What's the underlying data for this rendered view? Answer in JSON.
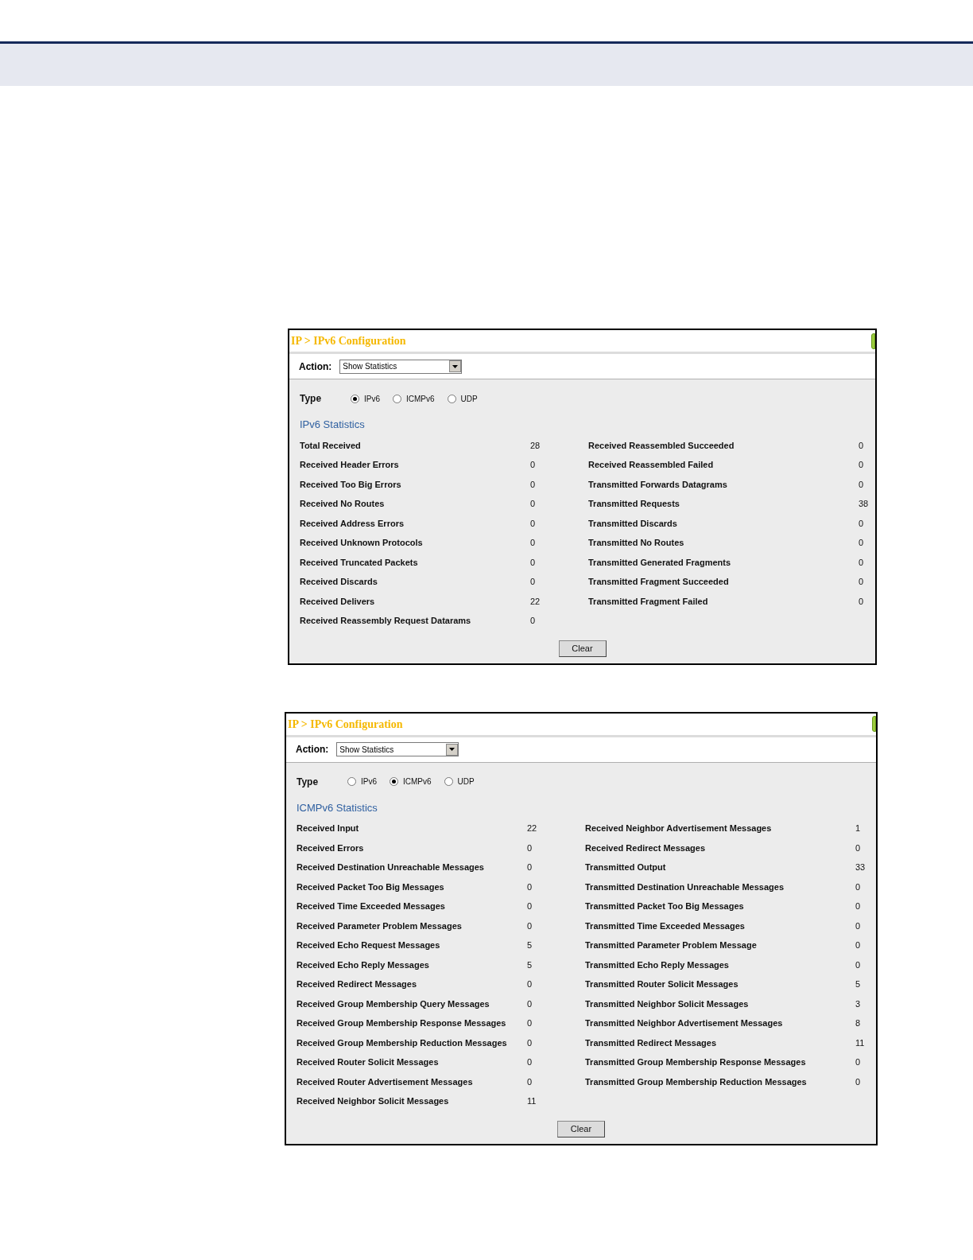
{
  "panels": [
    {
      "title": "IP > IPv6 Configuration",
      "action_label": "Action:",
      "action_value": "Show Statistics",
      "type_label": "Type",
      "types": [
        {
          "label": "IPv6",
          "selected": true
        },
        {
          "label": "ICMPv6",
          "selected": false
        },
        {
          "label": "UDP",
          "selected": false
        }
      ],
      "section_title": "IPv6 Statistics",
      "left": [
        {
          "label": "Total Received",
          "value": "28"
        },
        {
          "label": "Received Header Errors",
          "value": "0"
        },
        {
          "label": "Received Too Big Errors",
          "value": "0"
        },
        {
          "label": "Received No Routes",
          "value": "0"
        },
        {
          "label": "Received Address Errors",
          "value": "0"
        },
        {
          "label": "Received Unknown Protocols",
          "value": "0"
        },
        {
          "label": "Received Truncated Packets",
          "value": "0"
        },
        {
          "label": "Received Discards",
          "value": "0"
        },
        {
          "label": "Received Delivers",
          "value": "22"
        },
        {
          "label": "Received Reassembly Request Datarams",
          "value": "0"
        }
      ],
      "right": [
        {
          "label": "Received Reassembled Succeeded",
          "value": "0"
        },
        {
          "label": "Received Reassembled Failed",
          "value": "0"
        },
        {
          "label": "Transmitted Forwards Datagrams",
          "value": "0"
        },
        {
          "label": "Transmitted Requests",
          "value": "38"
        },
        {
          "label": "Transmitted Discards",
          "value": "0"
        },
        {
          "label": "Transmitted No Routes",
          "value": "0"
        },
        {
          "label": "Transmitted Generated Fragments",
          "value": "0"
        },
        {
          "label": "Transmitted Fragment Succeeded",
          "value": "0"
        },
        {
          "label": "Transmitted Fragment Failed",
          "value": "0"
        }
      ],
      "button": "Clear"
    },
    {
      "title": "IP > IPv6 Configuration",
      "action_label": "Action:",
      "action_value": "Show Statistics",
      "type_label": "Type",
      "types": [
        {
          "label": "IPv6",
          "selected": false
        },
        {
          "label": "ICMPv6",
          "selected": true
        },
        {
          "label": "UDP",
          "selected": false
        }
      ],
      "section_title": "ICMPv6 Statistics",
      "left": [
        {
          "label": "Received Input",
          "value": "22"
        },
        {
          "label": "Received Errors",
          "value": "0"
        },
        {
          "label": "Received Destination Unreachable Messages",
          "value": "0"
        },
        {
          "label": "Received Packet Too Big Messages",
          "value": "0"
        },
        {
          "label": "Received Time Exceeded Messages",
          "value": "0"
        },
        {
          "label": "Received Parameter Problem Messages",
          "value": "0"
        },
        {
          "label": "Received Echo Request Messages",
          "value": "5"
        },
        {
          "label": "Received Echo Reply Messages",
          "value": "5"
        },
        {
          "label": "Received Redirect Messages",
          "value": "0"
        },
        {
          "label": "Received Group Membership Query Messages",
          "value": "0"
        },
        {
          "label": "Received Group Membership Response Messages",
          "value": "0"
        },
        {
          "label": "Received Group Membership Reduction Messages",
          "value": "0"
        },
        {
          "label": "Received Router Solicit Messages",
          "value": "0"
        },
        {
          "label": "Received Router Advertisement Messages",
          "value": "0"
        },
        {
          "label": "Received Neighbor Solicit Messages",
          "value": "11"
        }
      ],
      "right": [
        {
          "label": "Received Neighbor Advertisement Messages",
          "value": "1"
        },
        {
          "label": "Received Redirect Messages",
          "value": "0"
        },
        {
          "label": "Transmitted Output",
          "value": "33"
        },
        {
          "label": "Transmitted Destination Unreachable Messages",
          "value": "0"
        },
        {
          "label": "Transmitted Packet Too Big Messages",
          "value": "0"
        },
        {
          "label": "Transmitted Time Exceeded Messages",
          "value": "0"
        },
        {
          "label": "Transmitted Parameter Problem Message",
          "value": "0"
        },
        {
          "label": "Transmitted Echo Reply Messages",
          "value": "0"
        },
        {
          "label": "Transmitted Router Solicit Messages",
          "value": "5"
        },
        {
          "label": "Transmitted Neighbor Solicit Messages",
          "value": "3"
        },
        {
          "label": "Transmitted Neighbor Advertisement Messages",
          "value": "8"
        },
        {
          "label": "Transmitted Redirect Messages",
          "value": "11"
        },
        {
          "label": "Transmitted Group Membership Response Messages",
          "value": "0"
        },
        {
          "label": "Transmitted Group Membership Reduction Messages",
          "value": "0"
        }
      ],
      "button": "Clear"
    }
  ]
}
